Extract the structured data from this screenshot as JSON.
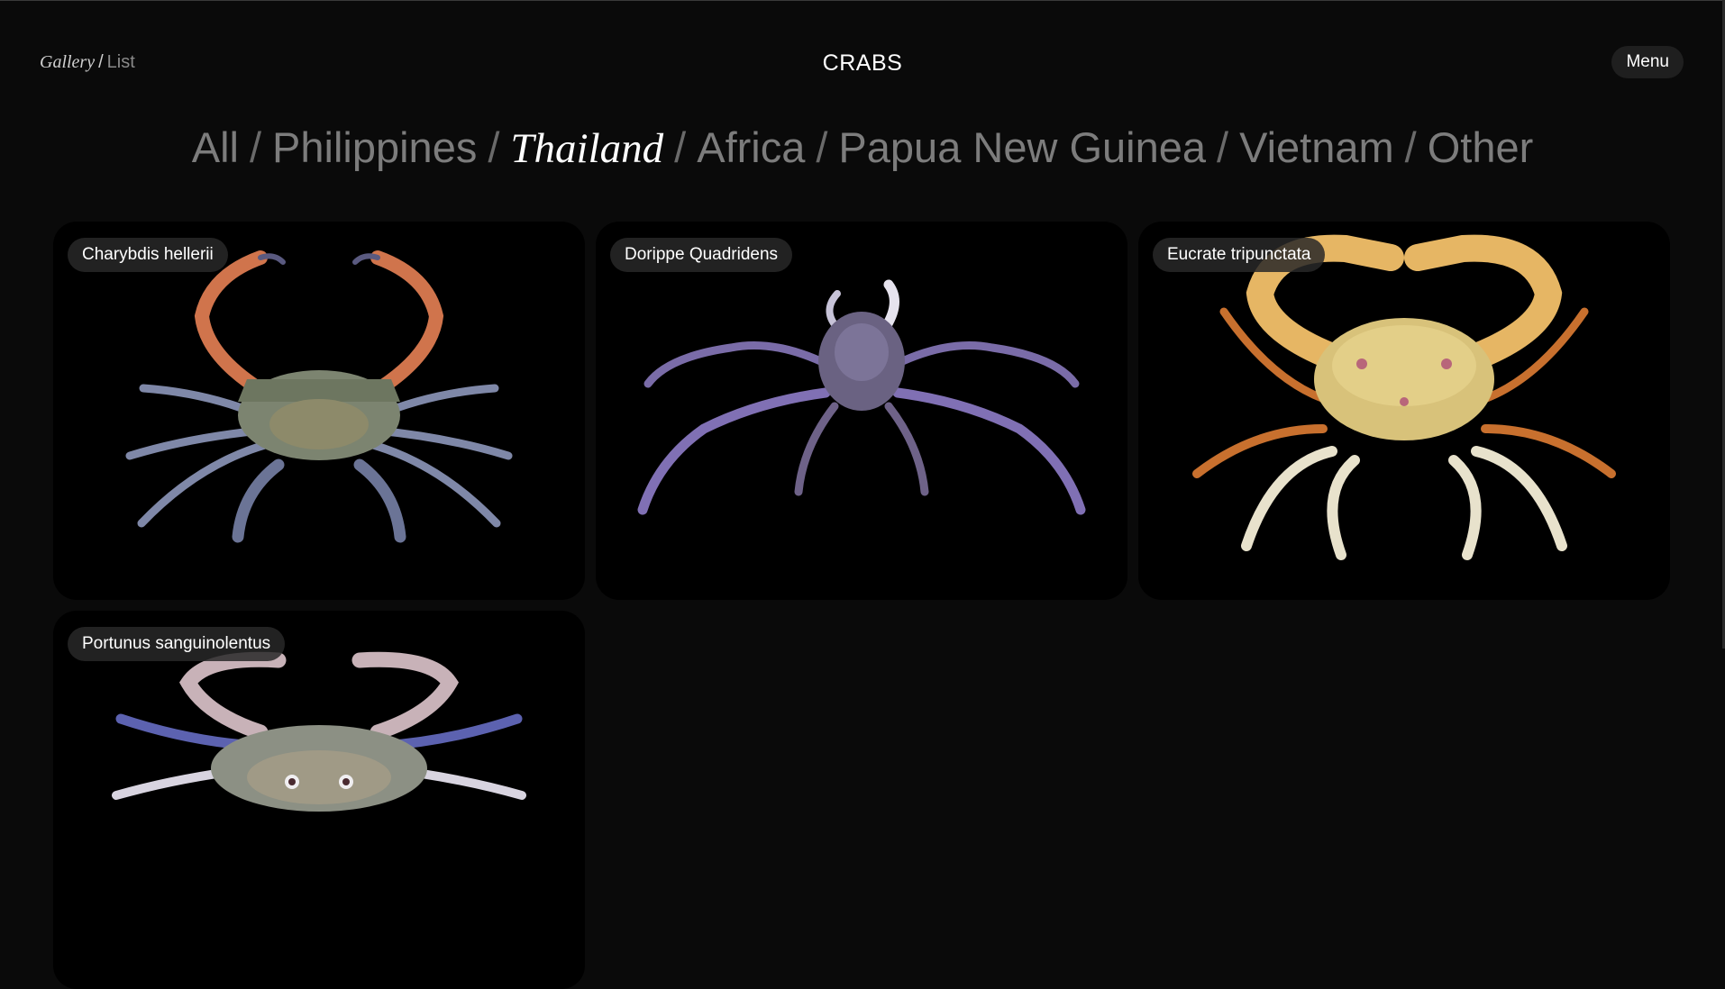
{
  "header": {
    "view_gallery": "Gallery",
    "view_separator": "/",
    "view_list": "List",
    "title": "CRABS",
    "menu_label": "Menu"
  },
  "filters": {
    "items": [
      "All",
      "Philippines",
      "Thailand",
      "Africa",
      "Papua New Guinea",
      "Vietnam",
      "Other"
    ],
    "separator": "/",
    "active": "Thailand"
  },
  "cards": [
    {
      "name": "Charybdis hellerii",
      "icon": "crab-blue-orange-image"
    },
    {
      "name": "Dorippe Quadridens",
      "icon": "crab-purple-image"
    },
    {
      "name": "Eucrate tripunctata",
      "icon": "crab-yellow-orange-image"
    },
    {
      "name": "Portunus sanguinolentus",
      "icon": "crab-blue-spotted-image"
    }
  ],
  "colors": {
    "background": "#0a0a0a",
    "card": "#000000",
    "pill": "#1f1f1f",
    "inactive_text": "#7c7c7c"
  }
}
